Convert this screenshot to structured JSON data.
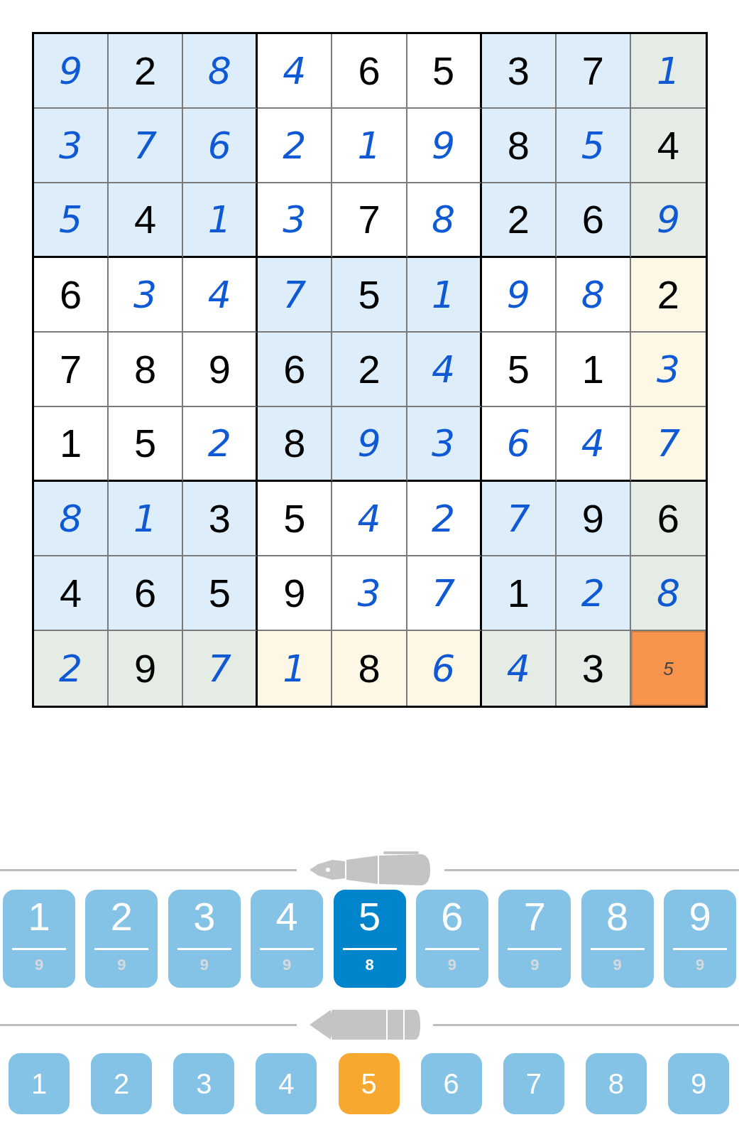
{
  "board": {
    "rows": [
      [
        {
          "value": "9",
          "kind": "entered",
          "color": "#ddeefa",
          "selected": false
        },
        {
          "value": "2",
          "kind": "given",
          "color": "#ddeefa",
          "selected": false
        },
        {
          "value": "8",
          "kind": "entered",
          "color": "#ddeefa",
          "selected": false
        },
        {
          "value": "4",
          "kind": "entered",
          "color": "#ffffff",
          "selected": false
        },
        {
          "value": "6",
          "kind": "given",
          "color": "#ffffff",
          "selected": false
        },
        {
          "value": "5",
          "kind": "given",
          "color": "#ffffff",
          "selected": false
        },
        {
          "value": "3",
          "kind": "given",
          "color": "#ddeefa",
          "selected": false
        },
        {
          "value": "7",
          "kind": "given",
          "color": "#ddeefa",
          "selected": false
        },
        {
          "value": "1",
          "kind": "entered",
          "color": "#e5ebe5",
          "selected": false
        }
      ],
      [
        {
          "value": "3",
          "kind": "entered",
          "color": "#ddeefa",
          "selected": false
        },
        {
          "value": "7",
          "kind": "entered",
          "color": "#ddeefa",
          "selected": false
        },
        {
          "value": "6",
          "kind": "entered",
          "color": "#ddeefa",
          "selected": false
        },
        {
          "value": "2",
          "kind": "entered",
          "color": "#ffffff",
          "selected": false
        },
        {
          "value": "1",
          "kind": "entered",
          "color": "#ffffff",
          "selected": false
        },
        {
          "value": "9",
          "kind": "entered",
          "color": "#ffffff",
          "selected": false
        },
        {
          "value": "8",
          "kind": "given",
          "color": "#ddeefa",
          "selected": false
        },
        {
          "value": "5",
          "kind": "entered",
          "color": "#ddeefa",
          "selected": false
        },
        {
          "value": "4",
          "kind": "given",
          "color": "#e5ebe5",
          "selected": false
        }
      ],
      [
        {
          "value": "5",
          "kind": "entered",
          "color": "#ddeefa",
          "selected": false
        },
        {
          "value": "4",
          "kind": "given",
          "color": "#ddeefa",
          "selected": false
        },
        {
          "value": "1",
          "kind": "entered",
          "color": "#ddeefa",
          "selected": false
        },
        {
          "value": "3",
          "kind": "entered",
          "color": "#ffffff",
          "selected": false
        },
        {
          "value": "7",
          "kind": "given",
          "color": "#ffffff",
          "selected": false
        },
        {
          "value": "8",
          "kind": "entered",
          "color": "#ffffff",
          "selected": false
        },
        {
          "value": "2",
          "kind": "given",
          "color": "#ddeefa",
          "selected": false
        },
        {
          "value": "6",
          "kind": "given",
          "color": "#ddeefa",
          "selected": false
        },
        {
          "value": "9",
          "kind": "entered",
          "color": "#e5ebe5",
          "selected": false
        }
      ],
      [
        {
          "value": "6",
          "kind": "given",
          "color": "#ffffff",
          "selected": false
        },
        {
          "value": "3",
          "kind": "entered",
          "color": "#ffffff",
          "selected": false
        },
        {
          "value": "4",
          "kind": "entered",
          "color": "#ffffff",
          "selected": false
        },
        {
          "value": "7",
          "kind": "entered",
          "color": "#ddeefa",
          "selected": false
        },
        {
          "value": "5",
          "kind": "given",
          "color": "#ddeefa",
          "selected": false
        },
        {
          "value": "1",
          "kind": "entered",
          "color": "#ddeefa",
          "selected": false
        },
        {
          "value": "9",
          "kind": "entered",
          "color": "#ffffff",
          "selected": false
        },
        {
          "value": "8",
          "kind": "entered",
          "color": "#ffffff",
          "selected": false
        },
        {
          "value": "2",
          "kind": "given",
          "color": "#fdf7e6",
          "selected": false
        }
      ],
      [
        {
          "value": "7",
          "kind": "given",
          "color": "#ffffff",
          "selected": false
        },
        {
          "value": "8",
          "kind": "given",
          "color": "#ffffff",
          "selected": false
        },
        {
          "value": "9",
          "kind": "given",
          "color": "#ffffff",
          "selected": false
        },
        {
          "value": "6",
          "kind": "given",
          "color": "#ddeefa",
          "selected": false
        },
        {
          "value": "2",
          "kind": "given",
          "color": "#ddeefa",
          "selected": false
        },
        {
          "value": "4",
          "kind": "entered",
          "color": "#ddeefa",
          "selected": false
        },
        {
          "value": "5",
          "kind": "given",
          "color": "#ffffff",
          "selected": false
        },
        {
          "value": "1",
          "kind": "given",
          "color": "#ffffff",
          "selected": false
        },
        {
          "value": "3",
          "kind": "entered",
          "color": "#fdf7e6",
          "selected": false
        }
      ],
      [
        {
          "value": "1",
          "kind": "given",
          "color": "#ffffff",
          "selected": false
        },
        {
          "value": "5",
          "kind": "given",
          "color": "#ffffff",
          "selected": false
        },
        {
          "value": "2",
          "kind": "entered",
          "color": "#ffffff",
          "selected": false
        },
        {
          "value": "8",
          "kind": "given",
          "color": "#ddeefa",
          "selected": false
        },
        {
          "value": "9",
          "kind": "entered",
          "color": "#ddeefa",
          "selected": false
        },
        {
          "value": "3",
          "kind": "entered",
          "color": "#ddeefa",
          "selected": false
        },
        {
          "value": "6",
          "kind": "entered",
          "color": "#ffffff",
          "selected": false
        },
        {
          "value": "4",
          "kind": "entered",
          "color": "#ffffff",
          "selected": false
        },
        {
          "value": "7",
          "kind": "entered",
          "color": "#fdf7e6",
          "selected": false
        }
      ],
      [
        {
          "value": "8",
          "kind": "entered",
          "color": "#ddeefa",
          "selected": false
        },
        {
          "value": "1",
          "kind": "entered",
          "color": "#ddeefa",
          "selected": false
        },
        {
          "value": "3",
          "kind": "given",
          "color": "#ddeefa",
          "selected": false
        },
        {
          "value": "5",
          "kind": "given",
          "color": "#ffffff",
          "selected": false
        },
        {
          "value": "4",
          "kind": "entered",
          "color": "#ffffff",
          "selected": false
        },
        {
          "value": "2",
          "kind": "entered",
          "color": "#ffffff",
          "selected": false
        },
        {
          "value": "7",
          "kind": "entered",
          "color": "#ddeefa",
          "selected": false
        },
        {
          "value": "9",
          "kind": "given",
          "color": "#ddeefa",
          "selected": false
        },
        {
          "value": "6",
          "kind": "given",
          "color": "#e5ebe5",
          "selected": false
        }
      ],
      [
        {
          "value": "4",
          "kind": "given",
          "color": "#ddeefa",
          "selected": false
        },
        {
          "value": "6",
          "kind": "given",
          "color": "#ddeefa",
          "selected": false
        },
        {
          "value": "5",
          "kind": "given",
          "color": "#ddeefa",
          "selected": false
        },
        {
          "value": "9",
          "kind": "given",
          "color": "#ffffff",
          "selected": false
        },
        {
          "value": "3",
          "kind": "entered",
          "color": "#ffffff",
          "selected": false
        },
        {
          "value": "7",
          "kind": "entered",
          "color": "#ffffff",
          "selected": false
        },
        {
          "value": "1",
          "kind": "given",
          "color": "#ddeefa",
          "selected": false
        },
        {
          "value": "2",
          "kind": "entered",
          "color": "#ddeefa",
          "selected": false
        },
        {
          "value": "8",
          "kind": "entered",
          "color": "#e5ebe5",
          "selected": false
        }
      ],
      [
        {
          "value": "2",
          "kind": "entered",
          "color": "#e5ebe5",
          "selected": false
        },
        {
          "value": "9",
          "kind": "given",
          "color": "#e5ebe5",
          "selected": false
        },
        {
          "value": "7",
          "kind": "entered",
          "color": "#e5ebe5",
          "selected": false
        },
        {
          "value": "1",
          "kind": "entered",
          "color": "#fdf7e6",
          "selected": false
        },
        {
          "value": "8",
          "kind": "given",
          "color": "#fdf7e6",
          "selected": false
        },
        {
          "value": "6",
          "kind": "entered",
          "color": "#fdf7e6",
          "selected": false
        },
        {
          "value": "4",
          "kind": "entered",
          "color": "#e5ebe5",
          "selected": false
        },
        {
          "value": "3",
          "kind": "given",
          "color": "#e5ebe5",
          "selected": false
        },
        {
          "value": "5",
          "kind": "note",
          "color": "#f9944c",
          "selected": true
        }
      ]
    ]
  },
  "pen_keys": [
    {
      "digit": "1",
      "count": "9",
      "selected": false
    },
    {
      "digit": "2",
      "count": "9",
      "selected": false
    },
    {
      "digit": "3",
      "count": "9",
      "selected": false
    },
    {
      "digit": "4",
      "count": "9",
      "selected": false
    },
    {
      "digit": "5",
      "count": "8",
      "selected": true
    },
    {
      "digit": "6",
      "count": "9",
      "selected": false
    },
    {
      "digit": "7",
      "count": "9",
      "selected": false
    },
    {
      "digit": "8",
      "count": "9",
      "selected": false
    },
    {
      "digit": "9",
      "count": "9",
      "selected": false
    }
  ],
  "pencil_keys": [
    {
      "digit": "1",
      "selected": false
    },
    {
      "digit": "2",
      "selected": false
    },
    {
      "digit": "3",
      "selected": false
    },
    {
      "digit": "4",
      "selected": false
    },
    {
      "digit": "5",
      "selected": true
    },
    {
      "digit": "6",
      "selected": false
    },
    {
      "digit": "7",
      "selected": false
    },
    {
      "digit": "8",
      "selected": false
    },
    {
      "digit": "9",
      "selected": false
    }
  ]
}
